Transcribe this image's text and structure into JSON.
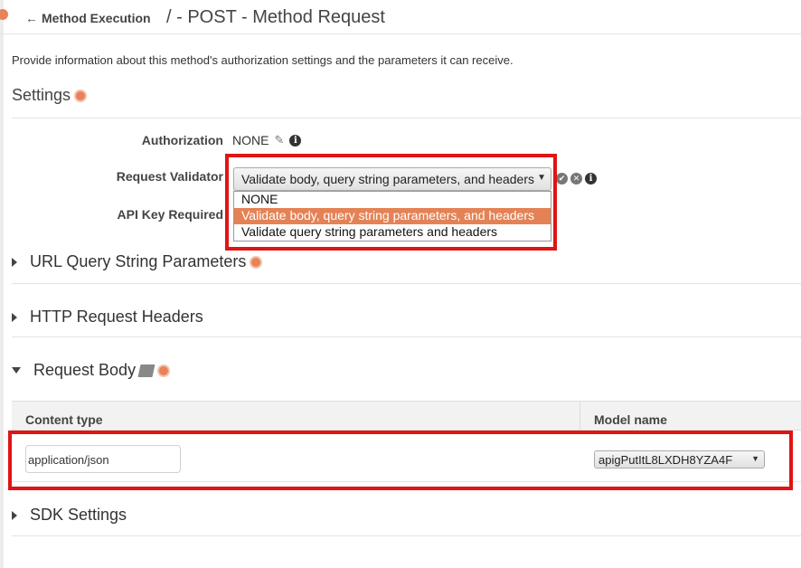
{
  "header": {
    "back_label": "Method Execution",
    "title": "/ - POST - Method Request"
  },
  "intro_text": "Provide information about this method's authorization settings and the parameters it can receive.",
  "settings": {
    "heading": "Settings",
    "authorization_label": "Authorization",
    "authorization_value": "NONE",
    "request_validator_label": "Request Validator",
    "request_validator_value": "Validate body, query string parameters, and headers",
    "request_validator_options": [
      "NONE",
      "Validate body, query string parameters, and headers",
      "Validate query string parameters and headers"
    ],
    "api_key_label": "API Key Required"
  },
  "sections": {
    "url_query": "URL Query String Parameters",
    "http_headers": "HTTP Request Headers",
    "request_body": "Request Body",
    "sdk_settings": "SDK Settings"
  },
  "request_body_table": {
    "col_content_type": "Content type",
    "col_model_name": "Model name",
    "rows": [
      {
        "content_type": "application/json",
        "model_name": "apigPutItL8LXDH8YZA4F"
      }
    ]
  },
  "colors": {
    "accent": "#e8825a",
    "selected_option": "#e48256",
    "highlight_box": "#e01414"
  }
}
